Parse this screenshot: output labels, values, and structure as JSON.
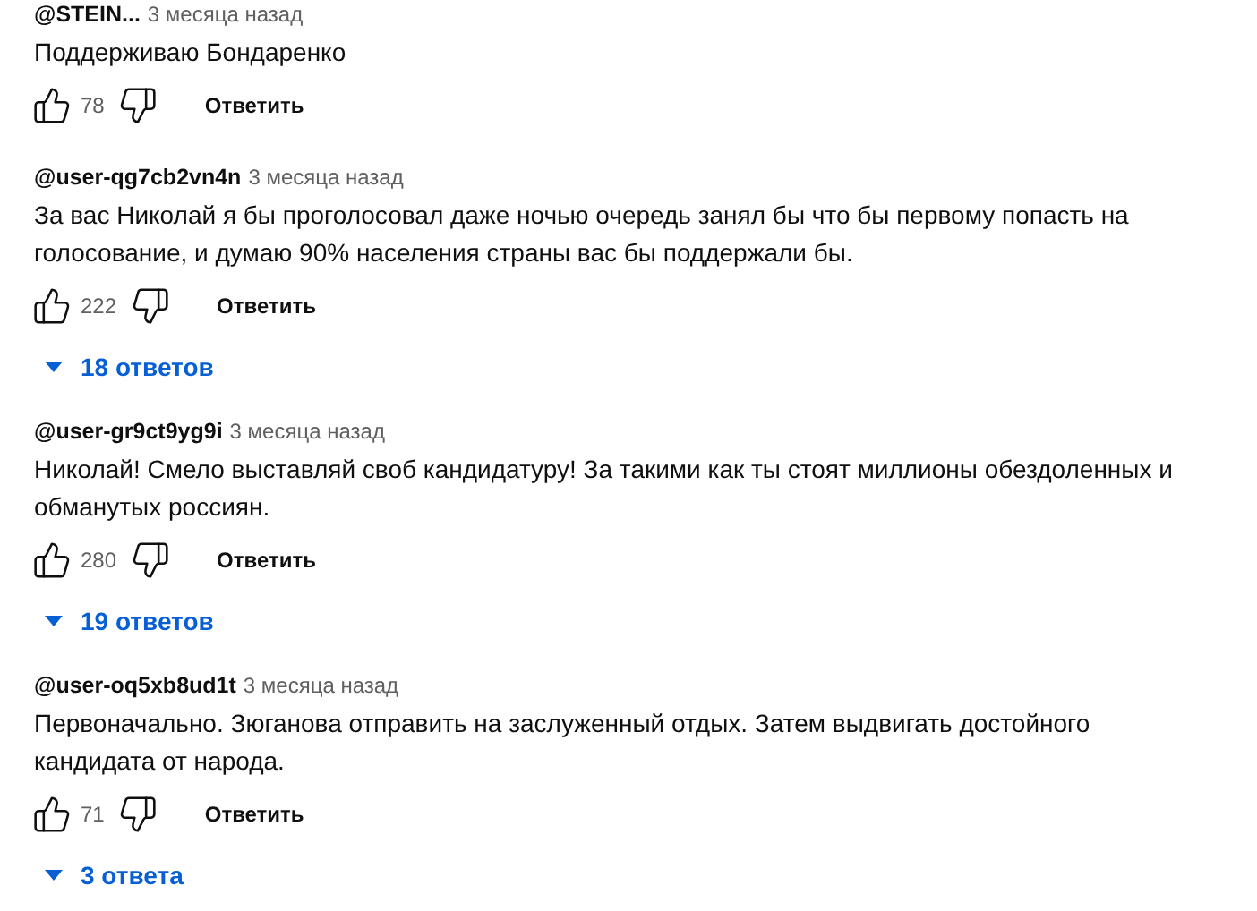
{
  "comments": [
    {
      "author": "@STEIN...",
      "time": "3 месяца назад",
      "text": "Поддерживаю Бондаренко",
      "likes": "78",
      "reply": "Ответить"
    },
    {
      "author": "@user-qg7cb2vn4n",
      "time": "3 месяца назад",
      "text": "За вас Николай я бы проголосовал даже ночью очередь занял бы что бы первому попасть на голосование, и думаю 90% населения страны вас бы поддержали бы.",
      "likes": "222",
      "reply": "Ответить",
      "replies": "18 ответов",
      "replies_expanded": false
    },
    {
      "author": "@user-gr9ct9yg9i",
      "time": "3 месяца назад",
      "text": "Николай! Смело выставляй своб кандидатуру! За такими как ты стоят миллионы обездоленных и обманутых россиян.",
      "likes": "280",
      "reply": "Ответить",
      "replies": "19 ответов",
      "replies_expanded": false
    },
    {
      "author": "@user-oq5xb8ud1t",
      "time": "3 месяца назад",
      "text": "Первоначально. Зюганова отправить на заслуженный отдых. Затем выдвигать достойного кандидата от народа.",
      "likes": "71",
      "reply": "Ответить",
      "replies": "3 ответа",
      "replies_expanded": false
    }
  ]
}
